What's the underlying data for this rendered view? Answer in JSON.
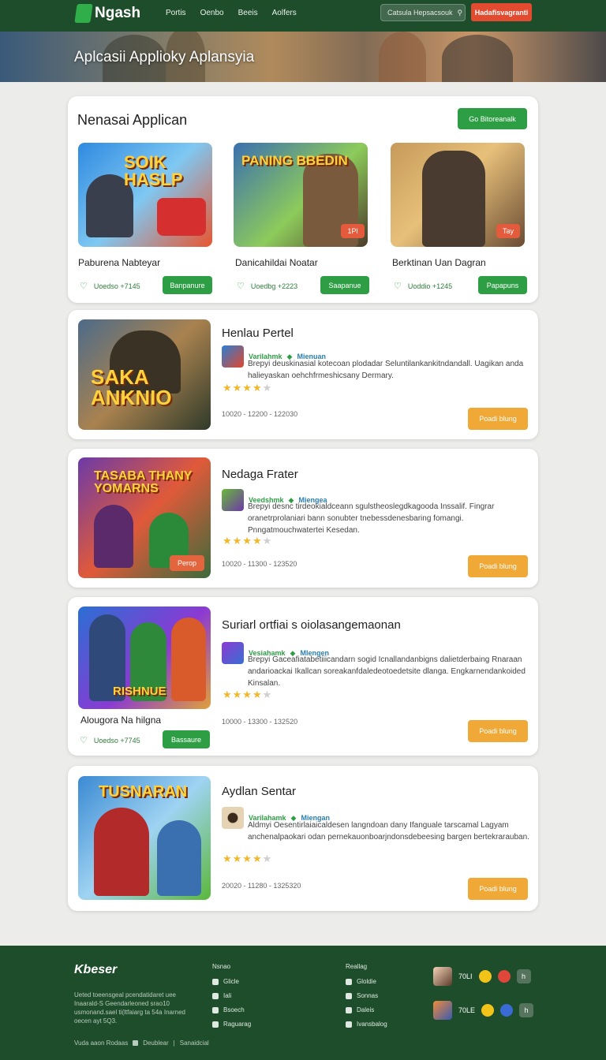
{
  "header": {
    "logo": "Ngash",
    "nav": [
      "Portis",
      "Oenbo",
      "Beeis",
      "Aolfers"
    ],
    "search_label": "Catsula Hepsacsouk",
    "search_icon": "search-icon",
    "cta": "Hadafisvagranti"
  },
  "hero": {
    "title": "Aplcasii Applioky Aplansyia"
  },
  "featured": {
    "title": "Nenasai Applican",
    "button": "Go Bitoreanalk",
    "items": [
      {
        "art": "SOIK HASLP",
        "name": "Paburena Nabteyar",
        "meta": "Uoedso +7145",
        "button": "Banpanure",
        "badge": ""
      },
      {
        "art": "PANING BBEDIN",
        "name": "Danicahildai Noatar",
        "meta": "Uoedbg +2223",
        "button": "Saapanue",
        "badge": "1Pl"
      },
      {
        "art": "",
        "name": "Berktinan Uan Dagran",
        "meta": "Uoddio +1245",
        "button": "Papapuns",
        "badge": "Tay"
      }
    ]
  },
  "apps": [
    {
      "art": "SAKA ANKNIO",
      "title": "Henlau Pertel",
      "developer": "Varilahmk",
      "dev_tag": "Mienuan",
      "description": "Brepyi deuskinasial kotecoan plodadar Seluntilankankitndandall. Uagikan anda halieyaskan oehchfrmeshicsany Dermary.",
      "rating": 4,
      "dates": "10020 - 12200 - 122030",
      "button": "Poadi blung",
      "pill": "",
      "side_name": "",
      "side_meta": "",
      "side_button": ""
    },
    {
      "art": "TASABA THANY YOMARNS",
      "title": "Nedaga Frater",
      "developer": "Veedshmk",
      "dev_tag": "Miengea",
      "description": "Brepyi desnc tirdeokialdceann sgulstheoslegdkagooda Inssalif. Fingrar oranetrprolaniari bann sonubter tnebessdenesbaring fomangi. Pnngatmouchwatertei Kesedan.",
      "rating": 4,
      "dates": "10020 - 11300 - 123520",
      "button": "Poadi blung",
      "pill": "Perop",
      "side_name": "",
      "side_meta": "",
      "side_button": ""
    },
    {
      "art": "RISHNUE",
      "title": "Suriarl ortfiai s oiolasangemaonan",
      "developer": "Vesiahamk",
      "dev_tag": "Mlengen",
      "description": "Brepyi Gaceafiatabetiiicandarn sogid Icnallandanbigns dalietderbaing Rnaraan andarioackai Ikallcan soreakanfdaledeotoedetsite dlanga. Engkarnendankoided Kinsalan.",
      "rating": 4,
      "dates": "10000 - 13300 - 132520",
      "button": "Poadi blung",
      "pill": "",
      "side_name": "Alougora Na hilgna",
      "side_meta": "Uoedso +7745",
      "side_button": "Bassaure"
    },
    {
      "art": "TUSNARAN",
      "title": "Aydlan Sentar",
      "developer": "Varilahamk",
      "dev_tag": "Miengan",
      "description": "Aldmyi Oesentirlaiaicaldesen langndoan dany Ifanguale tarscamal Lagyam anchenalpaokari odan pernekauonboarjndonsdebeesing bargen bertekrarauban.",
      "rating": 4,
      "dates": "20020 - 11280 - 1325320",
      "button": "Poadi blung",
      "pill": "",
      "side_name": "",
      "side_meta": "",
      "side_button": ""
    }
  ],
  "footer": {
    "logo": "Kbeser",
    "desc": "Ueted toeensgeal pcendatidaret uee Inaarald-S Geendarleoned srao10 usmonand.sael ti(ltfaiarg ta 54a Inarned oecen ayt 5Q3.",
    "col1_head": "Nsnao",
    "col1": [
      "Glicle",
      "Iali",
      "Bsoech",
      "Raguarag"
    ],
    "col2_head": "Reallag",
    "col2": [
      "Gloldie",
      "Sonnas",
      "Daleis",
      "Ivansbalog"
    ],
    "social": [
      {
        "count": "70LI"
      },
      {
        "count": "70LE"
      }
    ],
    "bottom": [
      "Vuda aaon Rodaas",
      "Deublear",
      "Sanaidcial"
    ]
  },
  "colors": {
    "brand": "#1e4d2b",
    "accent_green": "#2e9e45",
    "accent_orange": "#f0a836",
    "cta_red": "#e24b2f"
  }
}
